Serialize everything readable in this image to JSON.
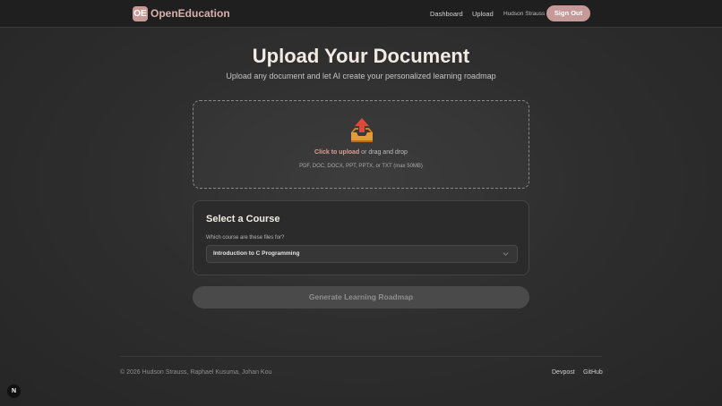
{
  "header": {
    "logo_badge": "OE",
    "logo_text": "OpenEducation",
    "nav": [
      {
        "label": "Dashboard"
      },
      {
        "label": "Upload"
      }
    ],
    "user_name": "Hudson Strauss",
    "sign_out_label": "Sign Out"
  },
  "main": {
    "title": "Upload Your Document",
    "subtitle": "Upload any document and let AI create your personalized learning roadmap",
    "upload": {
      "icon": "inbox-tray-upload-icon",
      "click_label": "Click to upload",
      "drag_label": "or drag and drop",
      "formats": "PDF, DOC, DOCX, PPT, PPTX, or TXT (max 50MB)"
    },
    "course": {
      "title": "Select a Course",
      "label": "Which course are these files for?",
      "selected": "Introduction to C Programming"
    },
    "generate_label": "Generate Learning Roadmap"
  },
  "footer": {
    "copyright": "© 2026 Hudson Strauss, Raphael Kusuma, Johan Kou",
    "links": [
      {
        "label": "Devpost"
      },
      {
        "label": "GitHub"
      }
    ]
  },
  "devtools_badge": "N",
  "colors": {
    "accent": "#c59a98",
    "background": "#2e2e2e",
    "header": "#1f1f1f"
  }
}
